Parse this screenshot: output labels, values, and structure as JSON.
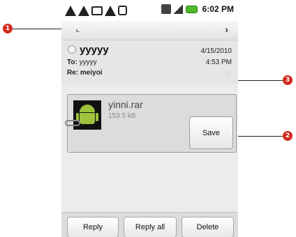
{
  "status_bar": {
    "time": "6:02 PM",
    "icons": [
      "warning-icon",
      "warning-icon",
      "keyboard-icon",
      "warning-icon",
      "usb-icon",
      "hsdpa-icon",
      "signal-icon",
      "battery-icon"
    ]
  },
  "nav": {
    "prev_icon": "chevron-left-icon",
    "prev_glyph": "‹",
    "next_icon": "chevron-right-icon",
    "next_glyph": "›"
  },
  "message": {
    "sender": "yyyyy",
    "to_label": "To:",
    "to_value": "yyyyy",
    "subject_label": "Re:",
    "subject_value": "meiyoi",
    "date": "4/15/2010",
    "time": "4:53 PM",
    "star_glyph": "☆"
  },
  "attachment": {
    "name": "yinni.rar",
    "size": "153.5 kB",
    "save_label": "Save"
  },
  "actions": {
    "reply_label": "Reply",
    "reply_all_label": "Reply all",
    "delete_label": "Delete"
  },
  "callouts": [
    "1",
    "2",
    "3"
  ],
  "colors": {
    "callout": "#d22a1f",
    "battery": "#4fba2a",
    "android_green": "#9fc23c"
  }
}
